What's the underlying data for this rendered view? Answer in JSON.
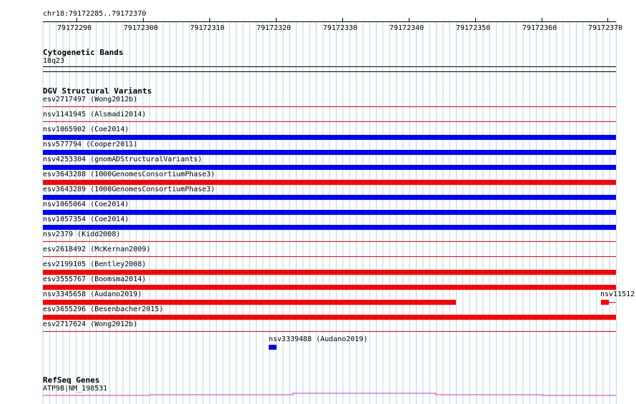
{
  "colors": {
    "deletion": "#0000ff",
    "duplication": "#ff0000",
    "grid": "#b4d9e8",
    "gene_line": "#cc33cc"
  },
  "ruler": {
    "range_label": "chr18:79172285..79172370",
    "ticks": [
      "79172290",
      "79172300",
      "79172310",
      "79172320",
      "79172330",
      "79172340",
      "79172350",
      "79172360",
      "79172370"
    ]
  },
  "cytoband": {
    "title": "Cytogenetic Bands",
    "band_label": "18q23"
  },
  "dgv": {
    "title": "DGV Structural Variants",
    "variants": [
      "esv2717497 (Wong2012b)",
      "nsv1141945 (Alsmadi2014)",
      "nsv1065902 (Coe2014)",
      "nsv577794 (Cooper2011)",
      "nsv4253304 (gnomADStructuralVariants)",
      "esv3643288 (1000GenomesConsortiumPhase3)",
      "esv3643289 (1000GenomesConsortiumPhase3)",
      "nsv1065064 (Coe2014)",
      "nsv1057354 (Coe2014)",
      "nsv2379 (Kidd2008)",
      "esv2618492 (McKernan2009)",
      "esv2199105 (Bentley2008)",
      "esv3555767 (Boomsma2014)",
      "nsv3345658 (Audano2019)",
      "esv3655296 (Besenbacher2015)",
      "esv2717624 (Wong2012b)"
    ],
    "cut_label": "nsv11512",
    "small_variant": "nsv3339488 (Audano2019)"
  },
  "refseq": {
    "title": "RefSeq Genes",
    "gene_label": "ATP9B|NM_198531"
  }
}
